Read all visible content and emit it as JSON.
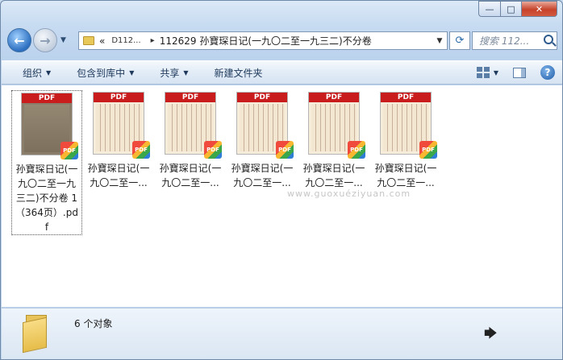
{
  "window": {
    "caption": {
      "minimize": "—",
      "maximize": "□",
      "close": "✕"
    }
  },
  "nav": {
    "back": "←",
    "forward": "→",
    "history_drop": "▼"
  },
  "address": {
    "overflow": "«",
    "crumbs": [
      "D112...",
      "112629 孙寶琛日记(一九〇二至一九三二)不分卷"
    ],
    "separator": "▸",
    "drop": "▼"
  },
  "refresh": "⟳",
  "search": {
    "placeholder": "搜索 112..."
  },
  "toolbar": {
    "organize": "组织",
    "include_library": "包含到库中",
    "share": "共享",
    "new_folder": "新建文件夹",
    "drop": "▼",
    "help": "?"
  },
  "files": [
    {
      "name": "孙寶琛日记(一九〇二至一九三二)不分卷 1（364页）.pdf",
      "band": "PDF",
      "badge": "PDF"
    },
    {
      "name": "孙寶琛日记(一九〇二至一...",
      "band": "PDF",
      "badge": "PDF"
    },
    {
      "name": "孙寶琛日记(一九〇二至一...",
      "band": "PDF",
      "badge": "PDF"
    },
    {
      "name": "孙寶琛日记(一九〇二至一...",
      "band": "PDF",
      "badge": "PDF"
    },
    {
      "name": "孙寶琛日记(一九〇二至一...",
      "band": "PDF",
      "badge": "PDF"
    },
    {
      "name": "孙寶琛日记(一九〇二至一...",
      "band": "PDF",
      "badge": "PDF"
    }
  ],
  "watermark": "www.guoxuéziyuan.com",
  "status": {
    "count": "6 个对象"
  },
  "colors": {
    "pdf_band": "#c91d1d",
    "folder": "#e8c35a",
    "close_button": "#c7432b"
  }
}
